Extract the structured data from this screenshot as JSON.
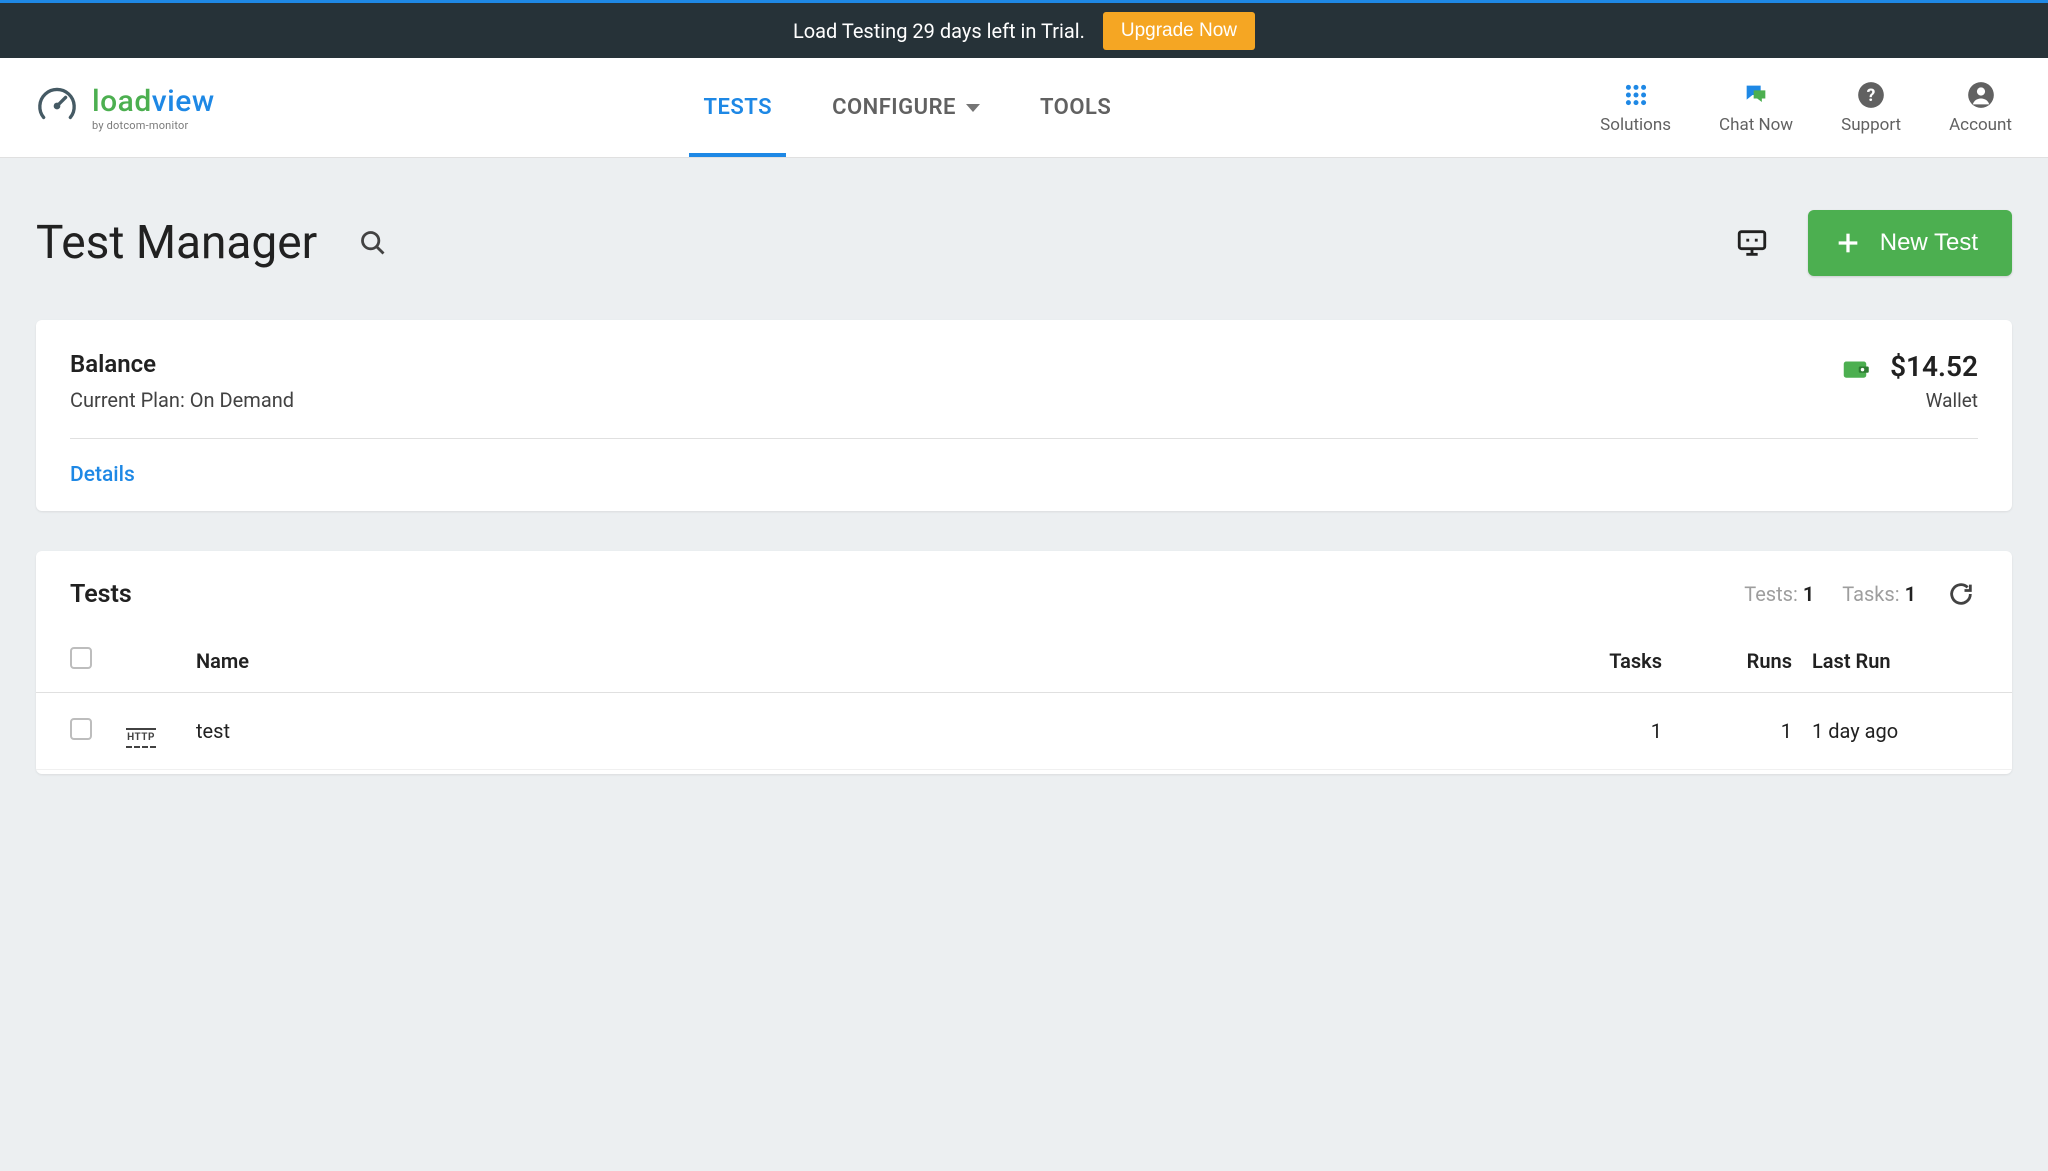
{
  "banner": {
    "text": "Load Testing 29 days left in Trial.",
    "button": "Upgrade Now"
  },
  "nav": {
    "tabs": [
      {
        "label": "TESTS",
        "active": true
      },
      {
        "label": "CONFIGURE",
        "active": false,
        "dropdown": true
      },
      {
        "label": "TOOLS",
        "active": false
      }
    ],
    "right": [
      {
        "label": "Solutions"
      },
      {
        "label": "Chat Now"
      },
      {
        "label": "Support"
      },
      {
        "label": "Account"
      }
    ],
    "logo_sub": "by dotcom-monitor"
  },
  "page": {
    "title": "Test Manager",
    "new_test_label": "New Test"
  },
  "balance": {
    "title": "Balance",
    "plan_prefix": "Current Plan: ",
    "plan_name": "On Demand",
    "amount": "$14.52",
    "wallet_label": "Wallet",
    "details_link": "Details"
  },
  "tests": {
    "title": "Tests",
    "tests_label": "Tests:",
    "tests_count": "1",
    "tasks_label": "Tasks:",
    "tasks_count": "1",
    "columns": {
      "name": "Name",
      "tasks": "Tasks",
      "runs": "Runs",
      "last": "Last Run"
    },
    "rows": [
      {
        "name": "test",
        "tasks": "1",
        "runs": "1",
        "last": "1 day ago"
      }
    ]
  }
}
